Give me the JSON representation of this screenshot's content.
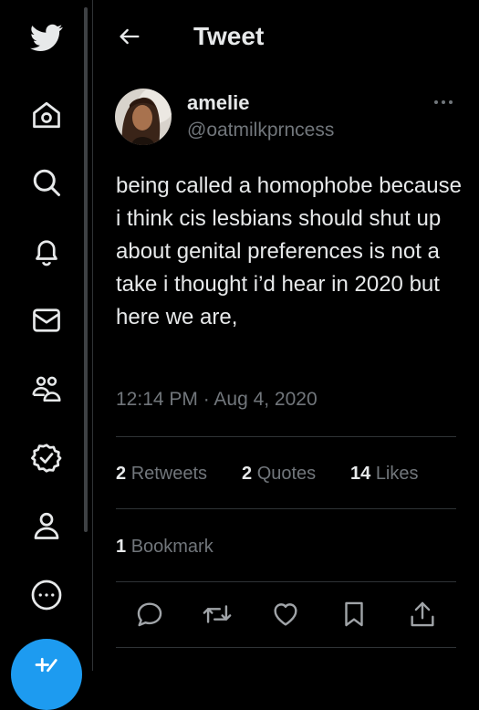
{
  "header": {
    "title": "Tweet"
  },
  "sidebar": {
    "items": [
      {
        "icon": "twitter-logo-icon"
      },
      {
        "icon": "home-icon"
      },
      {
        "icon": "search-icon"
      },
      {
        "icon": "bell-icon"
      },
      {
        "icon": "mail-icon"
      },
      {
        "icon": "communities-icon"
      },
      {
        "icon": "verified-icon"
      },
      {
        "icon": "profile-icon"
      },
      {
        "icon": "more-circle-icon"
      },
      {
        "icon": "compose-icon"
      }
    ]
  },
  "tweet": {
    "display_name": "amelie",
    "handle": "@oatmilkprncess",
    "text": "being called a homophobe because i think cis lesbians should shut up about genital preferences is not a take i thought i’d hear in 2020 but here we are,",
    "timestamp": "12:14 PM · Aug 4, 2020"
  },
  "stats": {
    "retweets_count": "2",
    "retweets_label": "Retweets",
    "quotes_count": "2",
    "quotes_label": "Quotes",
    "likes_count": "14",
    "likes_label": "Likes",
    "bookmarks_count": "1",
    "bookmarks_label": "Bookmark"
  },
  "colors": {
    "background": "#000000",
    "text_primary": "#e7e9ea",
    "text_secondary": "#71767b",
    "accent": "#1d9bf0",
    "divider": "#2f3336"
  }
}
